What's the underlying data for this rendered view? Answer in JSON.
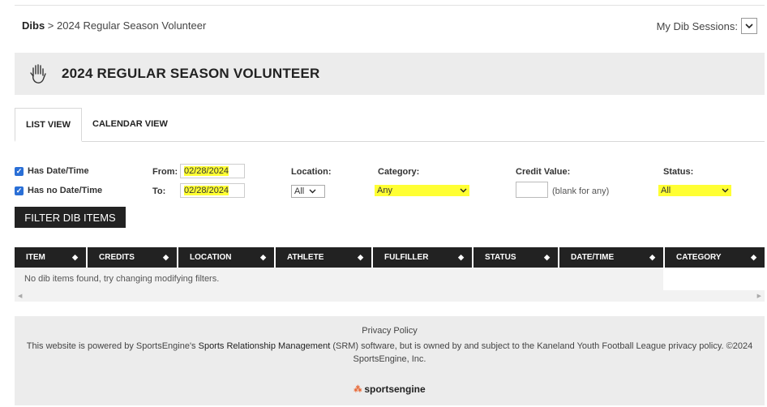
{
  "breadcrumb": {
    "root": "Dibs",
    "separator": " > ",
    "current": "2024 Regular Season Volunteer"
  },
  "sessions": {
    "label": "My Dib Sessions:",
    "icon": "chevron-down-icon"
  },
  "page": {
    "title": "2024 REGULAR SEASON VOLUNTEER",
    "icon": "hand-icon"
  },
  "tabs": [
    {
      "label": "LIST VIEW",
      "active": true
    },
    {
      "label": "CALENDAR VIEW",
      "active": false
    }
  ],
  "filters": {
    "has_date": {
      "label": "Has Date/Time",
      "checked": true
    },
    "no_date": {
      "label": "Has no Date/Time",
      "checked": true
    },
    "from_label": "From:",
    "from_value": "02/28/2024",
    "to_label": "To:",
    "to_value": "02/28/2024",
    "location_label": "Location:",
    "location_value": "All",
    "category_label": "Category:",
    "category_value": "Any",
    "credit_label": "Credit Value:",
    "credit_value": "",
    "credit_hint": "(blank for any)",
    "status_label": "Status:",
    "status_value": "All",
    "highlight_color": "#ffff33",
    "checkbox_color": "#2a6fd6"
  },
  "filter_button": "FILTER DIB ITEMS",
  "table": {
    "columns": [
      "ITEM",
      "CREDITS",
      "LOCATION",
      "ATHLETE",
      "FULFILLER",
      "STATUS",
      "DATE/TIME",
      "CATEGORY"
    ],
    "empty_message": "No dib items found, try changing modifying filters."
  },
  "footer": {
    "privacy": "Privacy Policy",
    "powered_prefix": "This website is powered by SportsEngine's ",
    "powered_link": "Sports Relationship Management",
    "powered_suffix": " (SRM) software, but is owned by and subject to the Kaneland Youth Football League privacy policy. ©2024 SportsEngine, Inc.",
    "logo_text": "sportsengine"
  }
}
